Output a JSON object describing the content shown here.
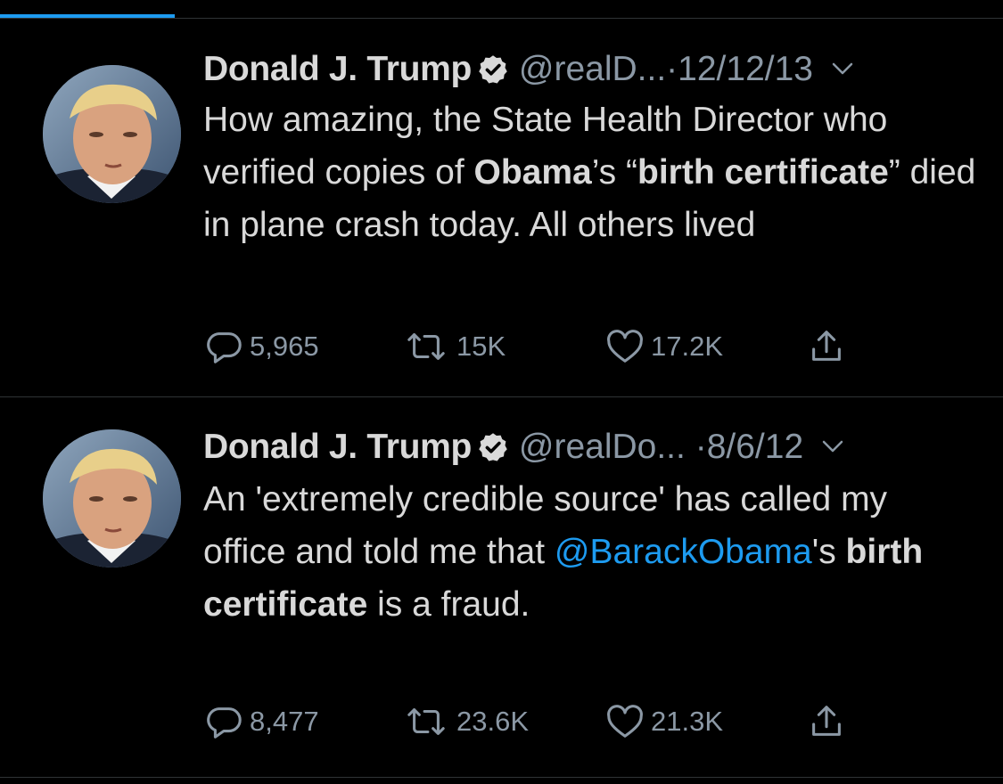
{
  "colors": {
    "background": "#000000",
    "text": "#d9d9d9",
    "muted": "#8b98a5",
    "accent": "#1d9bf0",
    "divider": "#2f3336"
  },
  "tweets": [
    {
      "name": "Donald J. Trump",
      "handle": "@realD...",
      "dot": "·",
      "date": "12/12/13",
      "icons": {
        "verified": "verified-badge-icon",
        "more": "chevron-down-icon"
      },
      "body": [
        "How amazing, the State Health Director who verified copies of ",
        "Obama",
        "’s “",
        "birth certificate",
        "” died in plane crash today. All others lived"
      ],
      "stats": {
        "replies": "5,965",
        "retweets": "15K",
        "likes": "17.2K"
      }
    },
    {
      "name": "Donald J. Trump",
      "handle": "@realDo...",
      "dot": "·",
      "date": "8/6/12",
      "icons": {
        "verified": "verified-badge-icon",
        "more": "chevron-down-icon"
      },
      "body": [
        "An 'extremely credible source' has called my office and told me that ",
        "@BarackObama",
        "'s ",
        "birth certificate",
        " is a fraud."
      ],
      "stats": {
        "replies": "8,477",
        "retweets": "23.6K",
        "likes": "21.3K"
      }
    }
  ]
}
